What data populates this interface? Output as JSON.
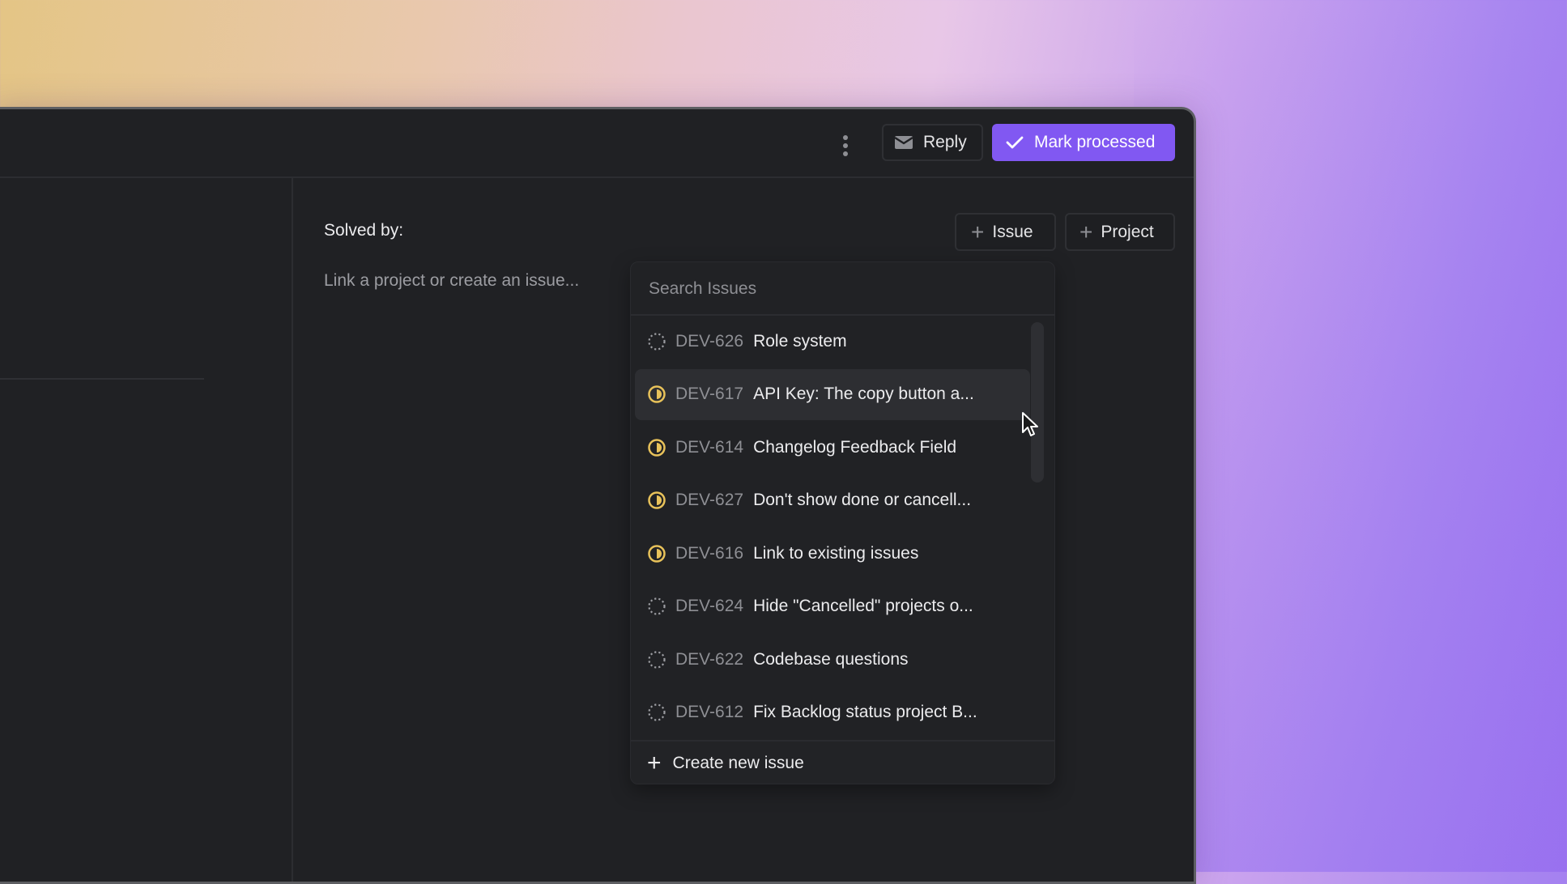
{
  "header": {
    "more_icon": "kebab-vertical-icon",
    "reply_label": "Reply",
    "reply_icon": "envelope-icon",
    "mark_processed_label": "Mark processed",
    "mark_processed_icon": "check-icon"
  },
  "colors": {
    "accent": "#8158f2",
    "in_progress": "#e8c25a",
    "backlog": "#9c9da2",
    "window_bg": "#202124"
  },
  "solved_section": {
    "label": "Solved by:",
    "placeholder": "Link a project or create an issue...",
    "add_issue_label": "Issue",
    "add_project_label": "Project"
  },
  "dropdown": {
    "search_placeholder": "Search Issues",
    "search_value": "",
    "items": [
      {
        "id": "DEV-626",
        "title": "Role system",
        "status": "backlog"
      },
      {
        "id": "DEV-617",
        "title": "API Key: The copy button a...",
        "status": "in-progress",
        "hovered": true
      },
      {
        "id": "DEV-614",
        "title": "Changelog Feedback Field",
        "status": "in-progress"
      },
      {
        "id": "DEV-627",
        "title": "Don't show done or cancell...",
        "status": "in-progress"
      },
      {
        "id": "DEV-616",
        "title": "Link to existing issues",
        "status": "in-progress"
      },
      {
        "id": "DEV-624",
        "title": "Hide \"Cancelled\" projects o...",
        "status": "backlog"
      },
      {
        "id": "DEV-622",
        "title": "Codebase questions",
        "status": "backlog"
      },
      {
        "id": "DEV-612",
        "title": "Fix Backlog status project B...",
        "status": "backlog"
      }
    ],
    "create_label": "Create new issue"
  }
}
